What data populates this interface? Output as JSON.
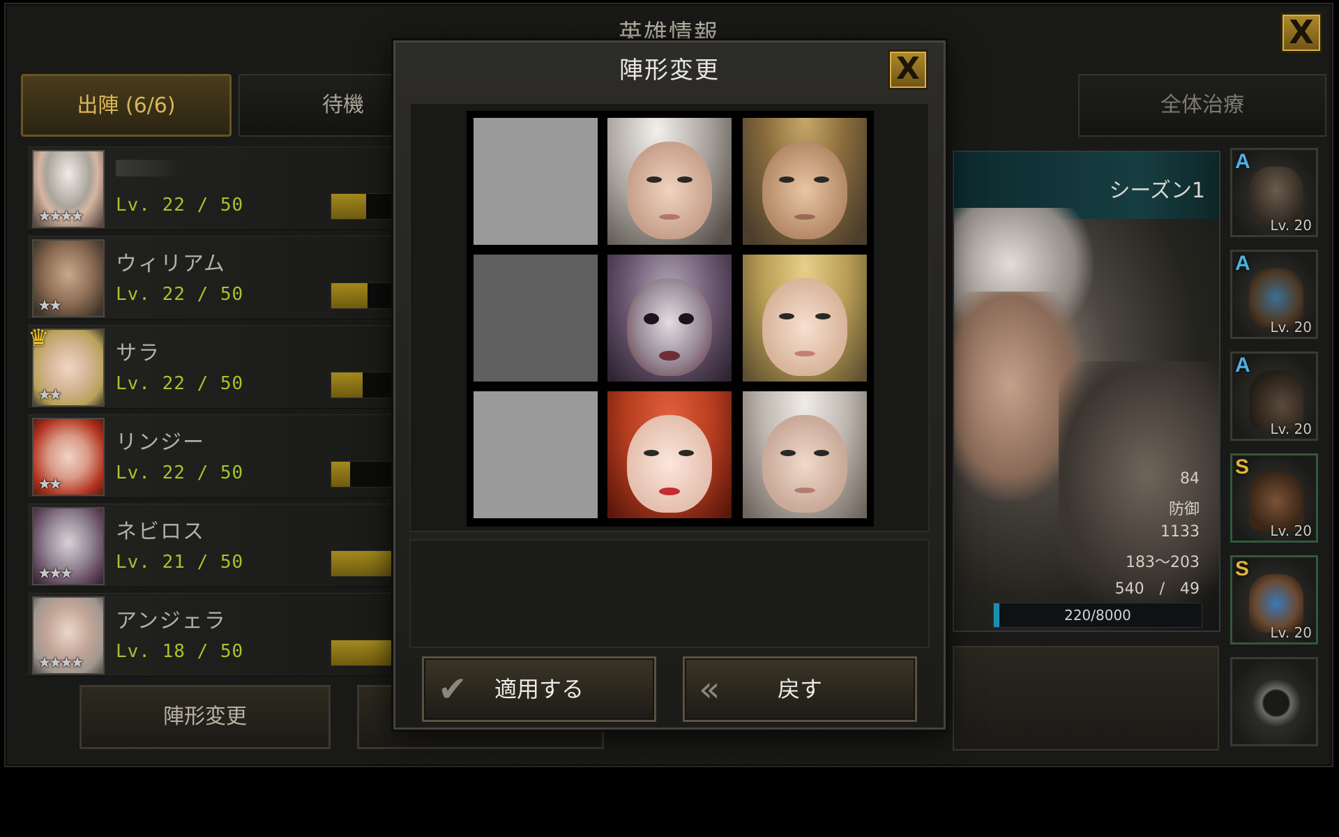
{
  "window": {
    "title": "英雄情報",
    "close_label": "X"
  },
  "tabs": {
    "deploy_label": "出陣 (6/6)",
    "standby_label": "待機"
  },
  "heal_all_label": "全体治療",
  "heroes": [
    {
      "name": "",
      "level": "Lv. 22 / 50",
      "stars": "★★★★",
      "xp_fill": 0.42,
      "leader": false
    },
    {
      "name": "ウィリアム",
      "level": "Lv. 22 / 50",
      "stars": "★★",
      "xp_fill": 0.44,
      "leader": false
    },
    {
      "name": "サラ",
      "level": "Lv. 22 / 50",
      "stars": "★★",
      "xp_fill": 0.38,
      "leader": true
    },
    {
      "name": "リンジー",
      "level": "Lv. 22 / 50",
      "stars": "★★",
      "xp_fill": 0.23,
      "leader": false
    },
    {
      "name": "ネビロス",
      "level": "Lv. 21 / 50",
      "stars": "★★★",
      "xp_fill": 1.0,
      "leader": false
    },
    {
      "name": "アンジェラ",
      "level": "Lv. 18 / 50",
      "stars": "★★★★",
      "xp_fill": 1.0,
      "leader": false
    }
  ],
  "bottom_buttons": {
    "formation_label": "陣形変更"
  },
  "character": {
    "season": "シーズン1",
    "stats": [
      "84",
      "防御",
      "1133",
      "183〜203",
      "540　/　49"
    ],
    "exp_text": "220/8000",
    "exp_fill": 0.0275
  },
  "equipment": [
    {
      "grade": "A",
      "level": "Lv. 20",
      "grade_color": "#4fb0e0",
      "art": "helmet-icon"
    },
    {
      "grade": "A",
      "level": "Lv. 20",
      "grade_color": "#4fb0e0",
      "art": "armor-icon"
    },
    {
      "grade": "A",
      "level": "Lv. 20",
      "grade_color": "#4fb0e0",
      "art": "gloves-icon"
    },
    {
      "grade": "S",
      "level": "Lv. 20",
      "grade_color": "#e0b33a",
      "art": "boots-icon"
    },
    {
      "grade": "S",
      "level": "Lv. 20",
      "grade_color": "#e0b33a",
      "art": "bracer-icon"
    },
    {
      "grade": "",
      "level": "",
      "grade_color": "",
      "art": "ring-icon"
    }
  ],
  "dialog": {
    "title": "陣形変更",
    "close_label": "X",
    "apply_label": "適用する",
    "back_label": "戻す",
    "formation": [
      [
        "empty-light",
        "hero-white-hair",
        "hero-blond-man"
      ],
      [
        "empty-dark",
        "hero-skull-demon",
        "hero-blonde-woman"
      ],
      [
        "empty-light",
        "hero-redhead",
        "hero-silver-woman"
      ]
    ]
  }
}
